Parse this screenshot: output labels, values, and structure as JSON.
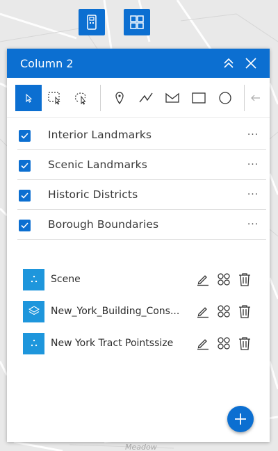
{
  "map": {
    "label": "Meadow"
  },
  "panel": {
    "title": "Column 2",
    "tools": [
      {
        "name": "select-pointer-icon",
        "active": true
      },
      {
        "name": "select-rectangle-icon",
        "active": false
      },
      {
        "name": "select-lasso-icon",
        "active": false
      },
      {
        "name": "draw-point-icon",
        "active": false
      },
      {
        "name": "draw-polyline-icon",
        "active": false
      },
      {
        "name": "draw-freehand-polygon-icon",
        "active": false
      },
      {
        "name": "draw-rectangle-icon",
        "active": false
      },
      {
        "name": "draw-circle-icon",
        "active": false
      },
      {
        "name": "undo-icon",
        "active": false
      }
    ],
    "layers": [
      {
        "label": "Interior Landmarks",
        "checked": true,
        "menu": "···"
      },
      {
        "label": "Scenic Landmarks",
        "checked": true,
        "menu": "···"
      },
      {
        "label": "Historic Districts",
        "checked": true,
        "menu": "···"
      },
      {
        "label": "Borough Boundaries",
        "checked": true,
        "menu": "···"
      }
    ],
    "sources": [
      {
        "label": "Scene",
        "icon": "points-icon"
      },
      {
        "label": "New_York_Building_Cons...",
        "icon": "layers-icon"
      },
      {
        "label": "New York Tract Pointssize",
        "icon": "points-icon"
      }
    ]
  },
  "colors": {
    "accent": "#0c6fd1",
    "source_icon": "#1e96dc",
    "map_bg": "#e9e9e9"
  }
}
